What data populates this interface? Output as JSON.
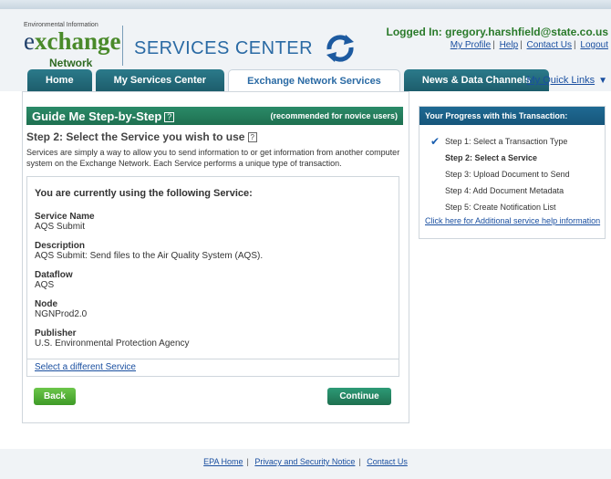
{
  "header": {
    "logo_small": "Environmental Information",
    "logo_main": "xchange",
    "logo_e": "e",
    "logo_network": "Network",
    "services_title": "SERVICES CENTER",
    "logged_in": "Logged In: gregory.harshfield@state.co.us",
    "links": [
      "My Profile",
      "Help",
      "Contact Us",
      "Logout"
    ]
  },
  "tabs": [
    {
      "label": "Home",
      "active": false
    },
    {
      "label": "My Services Center",
      "active": false
    },
    {
      "label": "Exchange Network Services",
      "active": true
    },
    {
      "label": "News & Data Channels",
      "active": false
    }
  ],
  "quick_links": "My Quick Links",
  "guide": {
    "title": "Guide Me Step-by-Step",
    "help_glyph": "?",
    "recommended": "(recommended for novice users)",
    "step_title": "Step 2: Select the Service you wish to use",
    "intro": "Services are simply a way to allow you to send information to or get information from another computer system on the Exchange Network. Each Service performs a unique type of transaction.",
    "current_header": "You are currently using the following Service:",
    "fields": [
      {
        "label": "Service Name",
        "value": "AQS Submit"
      },
      {
        "label": "Description",
        "value": "AQS Submit: Send files to the Air Quality System (AQS)."
      },
      {
        "label": "Dataflow",
        "value": "AQS"
      },
      {
        "label": "Node",
        "value": "NGNProd2.0"
      },
      {
        "label": "Publisher",
        "value": "U.S. Environmental Protection Agency"
      }
    ],
    "select_different": "Select a different Service",
    "back": "Back",
    "continue": "Continue"
  },
  "progress": {
    "title": "Your Progress with this Transaction:",
    "steps": [
      "Step 1: Select a Transaction Type",
      "Step 2: Select a Service",
      "Step 3: Upload Document to Send",
      "Step 4: Add Document Metadata",
      "Step 5: Create Notification List"
    ],
    "help_link": "Click here for Additional service help information"
  },
  "footer": {
    "links": [
      "EPA Home",
      "Privacy and Security Notice",
      "Contact Us"
    ]
  },
  "colors": {
    "tab_bg": "#1d5d6c",
    "guide_header": "#1e7050",
    "progress_header": "#16557a",
    "link": "#1a4fa0",
    "login_text": "#2a7a2a"
  }
}
